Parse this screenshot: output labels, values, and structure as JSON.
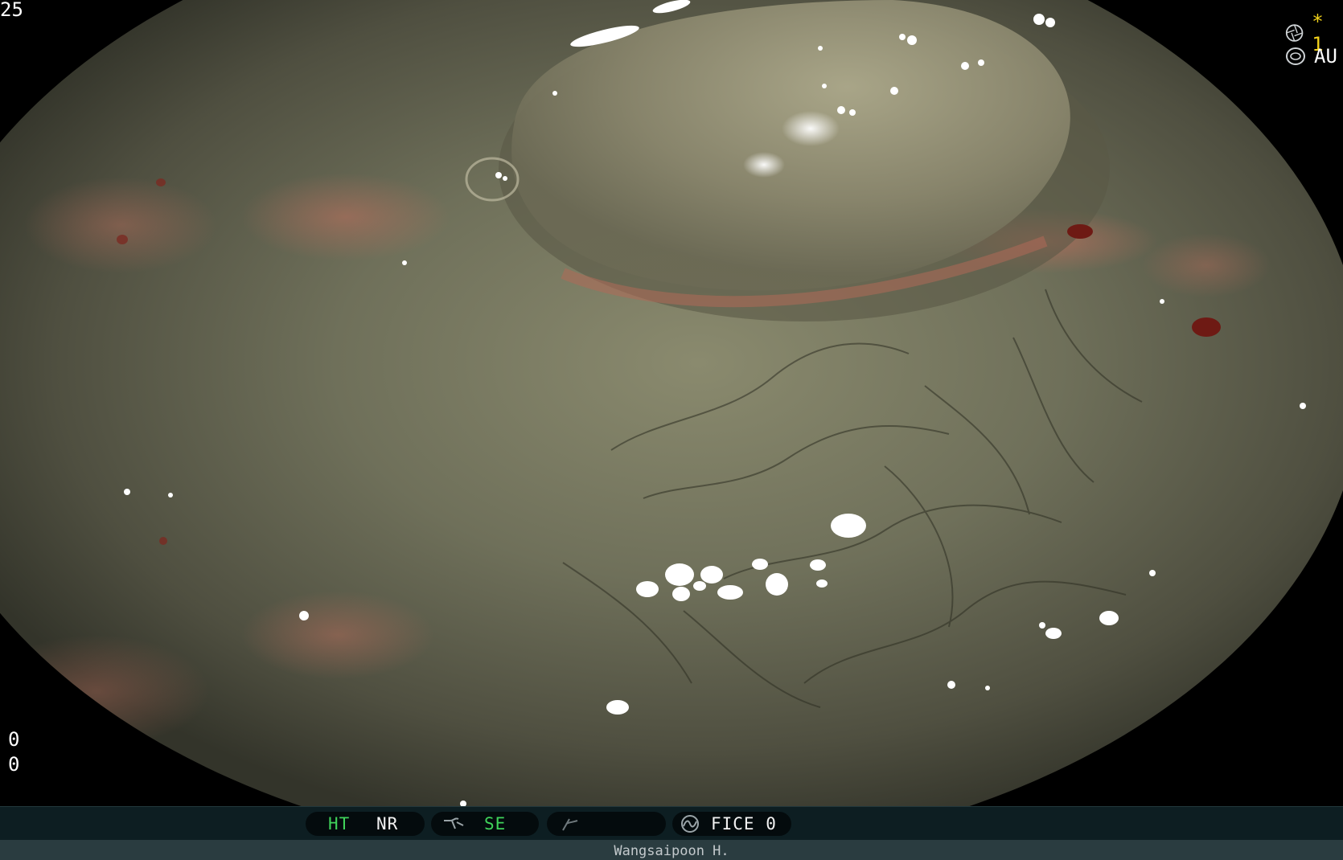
{
  "overlay": {
    "top_left_number": "25",
    "left_values": [
      "0",
      "0"
    ],
    "top_right": {
      "row1_star": "* 1",
      "row2_text": "AU"
    }
  },
  "status_bar": {
    "ht_label": "HT",
    "nr_label": "NR",
    "se_label": "SE",
    "fice_label": "FICE 0"
  },
  "footer": {
    "operator": "Wangsaipoon H."
  },
  "icons": {
    "shutter": "aperture-icon",
    "iris": "iris-icon",
    "structure_enhance": "structure-enhance-icon",
    "color_mode": "curve-icon",
    "fice": "fice-icon"
  },
  "colors": {
    "tissue": "#6f705a",
    "mucosa_red": "#b35a4a",
    "highlight": "#ffffff",
    "accent_green": "#3fd35a",
    "star_yellow": "#f2d21a"
  }
}
